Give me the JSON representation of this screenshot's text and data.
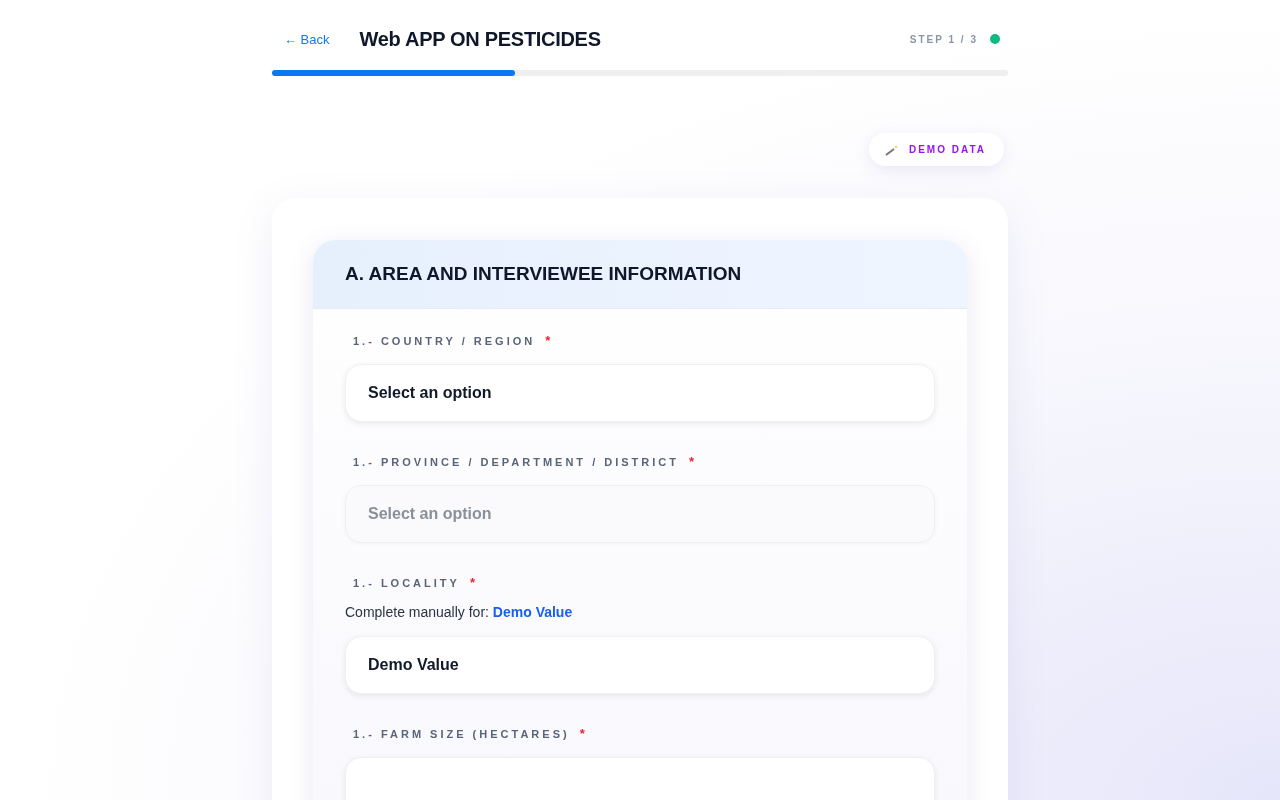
{
  "header": {
    "back": "← Back",
    "title": "Web APP ON PESTICIDES",
    "step": "STEP 1 / 3",
    "progress": {
      "level": 0.33
    }
  },
  "demo_button": "DEMO DATA",
  "required_mark": "*",
  "section": {
    "title": "A. AREA AND INTERVIEWEE INFORMATION",
    "fields": [
      {
        "label": "1.- COUNTRY / REGION",
        "required": true,
        "value": "Select an option",
        "disabled": false
      },
      {
        "label": "1.- PROVINCE / DEPARTMENT / DISTRICT",
        "required": true,
        "value": "Select an option",
        "disabled": true
      },
      {
        "label": "1.- LOCALITY",
        "required": true,
        "note": "Complete manually for: **Demo Value**",
        "value": "Demo Value",
        "disabled": false
      },
      {
        "label": "1.- FARM SIZE (HECTARES)",
        "required": true,
        "disabled": false
      }
    ]
  }
}
